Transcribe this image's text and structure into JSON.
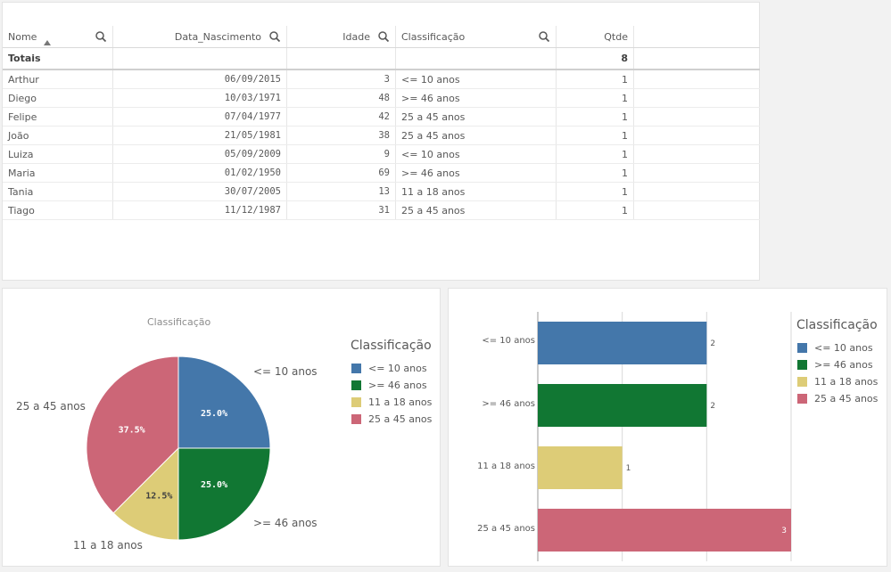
{
  "table": {
    "headers": [
      "Nome",
      "Data_Nascimento",
      "Idade",
      "Classificação",
      "Qtde"
    ],
    "totals_label": "Totais",
    "totals_qtde": "8",
    "rows": [
      {
        "nome": "Arthur",
        "data": "06/09/2015",
        "idade": "3",
        "classificacao": "<= 10 anos",
        "qtde": "1"
      },
      {
        "nome": "Diego",
        "data": "10/03/1971",
        "idade": "48",
        "classificacao": ">= 46 anos",
        "qtde": "1"
      },
      {
        "nome": "Felipe",
        "data": "07/04/1977",
        "idade": "42",
        "classificacao": "25 a 45 anos",
        "qtde": "1"
      },
      {
        "nome": "João",
        "data": "21/05/1981",
        "idade": "38",
        "classificacao": "25 a 45 anos",
        "qtde": "1"
      },
      {
        "nome": "Luiza",
        "data": "05/09/2009",
        "idade": "9",
        "classificacao": "<= 10 anos",
        "qtde": "1"
      },
      {
        "nome": "Maria",
        "data": "01/02/1950",
        "idade": "69",
        "classificacao": ">= 46 anos",
        "qtde": "1"
      },
      {
        "nome": "Tania",
        "data": "30/07/2005",
        "idade": "13",
        "classificacao": "11 a 18 anos",
        "qtde": "1"
      },
      {
        "nome": "Tiago",
        "data": "11/12/1987",
        "idade": "31",
        "classificacao": "25 a 45 anos",
        "qtde": "1"
      }
    ]
  },
  "colors": {
    "le10": "#4477aa",
    "ge46": "#117733",
    "a11_18": "#ddcc77",
    "a25_45": "#cc6677"
  },
  "chart_data": [
    {
      "type": "pie",
      "title": "Classificação",
      "legend_title": "Classificação",
      "legend_position": "right",
      "categories": [
        "<= 10 anos",
        ">= 46 anos",
        "11 a 18 anos",
        "25 a 45 anos"
      ],
      "values": [
        2,
        2,
        1,
        3
      ],
      "percent_labels": [
        "25.0%",
        "25.0%",
        "12.5%",
        "37.5%"
      ]
    },
    {
      "type": "bar",
      "orientation": "horizontal",
      "legend_title": "Classificação",
      "legend_position": "right",
      "categories": [
        "<= 10 anos",
        ">= 46 anos",
        "11 a 18 anos",
        "25 a 45 anos"
      ],
      "values": [
        2,
        2,
        1,
        3
      ],
      "xlim": [
        0,
        3
      ],
      "grid": true
    }
  ]
}
